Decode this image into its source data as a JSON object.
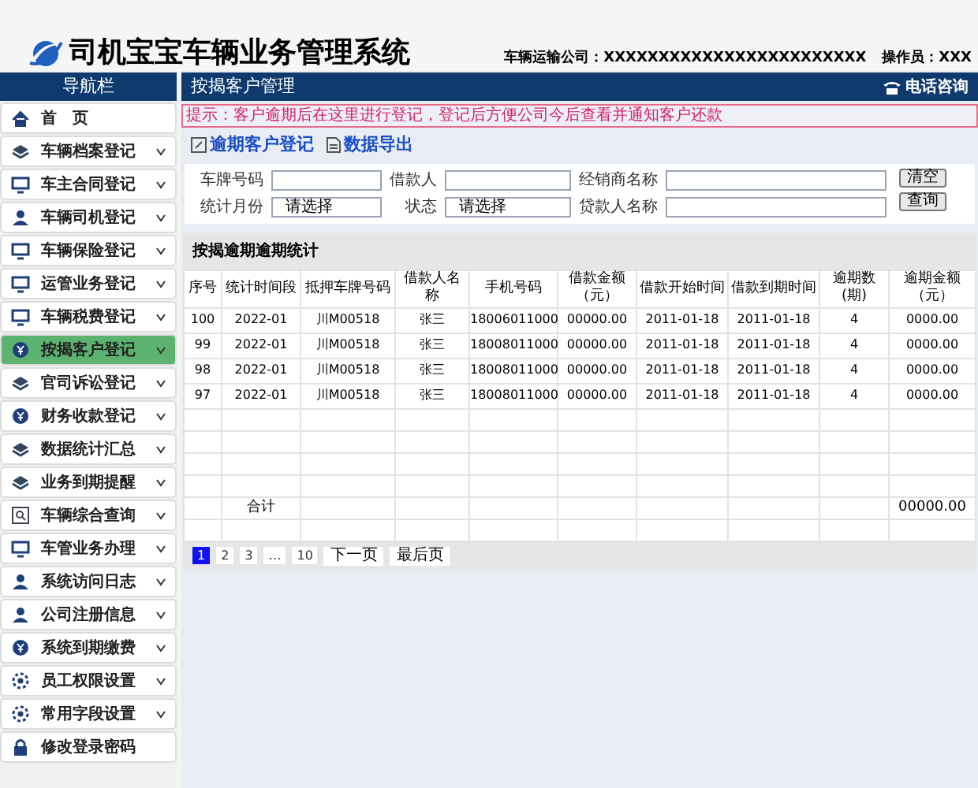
{
  "header": {
    "title": "司机宝宝车辆业务管理系统",
    "company_label": "车辆运输公司：",
    "company_value": "XXXXXXXXXXXXXXXXXXXXXXXX",
    "operator_label": "操作员：",
    "operator_value": "XXX"
  },
  "sidebar": {
    "title": "导航栏",
    "items": [
      {
        "label": "首　页",
        "expandable": false,
        "selected": false
      },
      {
        "label": "车辆档案登记",
        "expandable": true,
        "selected": false
      },
      {
        "label": "车主合同登记",
        "expandable": true,
        "selected": false
      },
      {
        "label": "车辆司机登记",
        "expandable": true,
        "selected": false
      },
      {
        "label": "车辆保险登记",
        "expandable": true,
        "selected": false
      },
      {
        "label": "运管业务登记",
        "expandable": true,
        "selected": false
      },
      {
        "label": "车辆税费登记",
        "expandable": true,
        "selected": false
      },
      {
        "label": "按揭客户登记",
        "expandable": true,
        "selected": true
      },
      {
        "label": "官司诉讼登记",
        "expandable": true,
        "selected": false
      },
      {
        "label": "财务收款登记",
        "expandable": true,
        "selected": false
      },
      {
        "label": "数据统计汇总",
        "expandable": true,
        "selected": false
      },
      {
        "label": "业务到期提醒",
        "expandable": true,
        "selected": false
      },
      {
        "label": "车辆综合查询",
        "expandable": true,
        "selected": false
      },
      {
        "label": "车管业务办理",
        "expandable": true,
        "selected": false
      },
      {
        "label": "系统访问日志",
        "expandable": true,
        "selected": false
      },
      {
        "label": "公司注册信息",
        "expandable": true,
        "selected": false
      },
      {
        "label": "系统到期缴费",
        "expandable": true,
        "selected": false
      },
      {
        "label": "员工权限设置",
        "expandable": true,
        "selected": false
      },
      {
        "label": "常用字段设置",
        "expandable": true,
        "selected": false
      },
      {
        "label": "修改登录密码",
        "expandable": false,
        "selected": false
      }
    ]
  },
  "main": {
    "title": "按揭客户管理",
    "phone_link": "电话咨询",
    "notice": "提示：客户逾期后在这里进行登记，登记后方便公司今后查看并通知客户还款",
    "actions": [
      "逾期客户登记",
      "数据导出"
    ],
    "filters": [
      {
        "label": "车牌号码",
        "kind": "text"
      },
      {
        "label": "借款人",
        "kind": "text"
      },
      {
        "label": "经销商名称",
        "kind": "text"
      },
      {
        "label": "统计月份",
        "kind": "select",
        "value": "请选择"
      },
      {
        "label": "状态",
        "kind": "select",
        "value": "请选择"
      },
      {
        "label": "贷款人名称",
        "kind": "text"
      }
    ],
    "buttons": [
      "清空",
      "查询"
    ],
    "table": {
      "title": "按揭逾期逾期统计",
      "columns": [
        "序号",
        "统计时间段",
        "抵押车牌号码",
        "借款人名称",
        "手机号码",
        "借款金额（元）",
        "借款开始时间",
        "借款到期时间",
        "逾期数(期)",
        "逾期金额（元）"
      ],
      "rows": [
        [
          "100",
          "2022-01",
          "川M00518",
          "张三",
          "18006011000",
          "00000.00",
          "2011-01-18",
          "2011-01-18",
          "4",
          "0000.00"
        ],
        [
          "99",
          "2022-01",
          "川M00518",
          "张三",
          "18008011000",
          "00000.00",
          "2011-01-18",
          "2011-01-18",
          "4",
          "0000.00"
        ],
        [
          "98",
          "2022-01",
          "川M00518",
          "张三",
          "18008011000",
          "00000.00",
          "2011-01-18",
          "2011-01-18",
          "4",
          "0000.00"
        ],
        [
          "97",
          "2022-01",
          "川M00518",
          "张三",
          "18008011000",
          "00000.00",
          "2011-01-18",
          "2011-01-18",
          "4",
          "0000.00"
        ]
      ],
      "total": {
        "label": "合计",
        "value": "00000.00"
      }
    },
    "pagination": {
      "pages": [
        {
          "label": "1",
          "selected": true
        },
        {
          "label": "2",
          "selected": false
        },
        {
          "label": "3",
          "selected": false
        },
        {
          "label": "…",
          "selected": false
        },
        {
          "label": "10",
          "selected": false
        }
      ],
      "next": "下一页",
      "last": "最后页"
    }
  }
}
